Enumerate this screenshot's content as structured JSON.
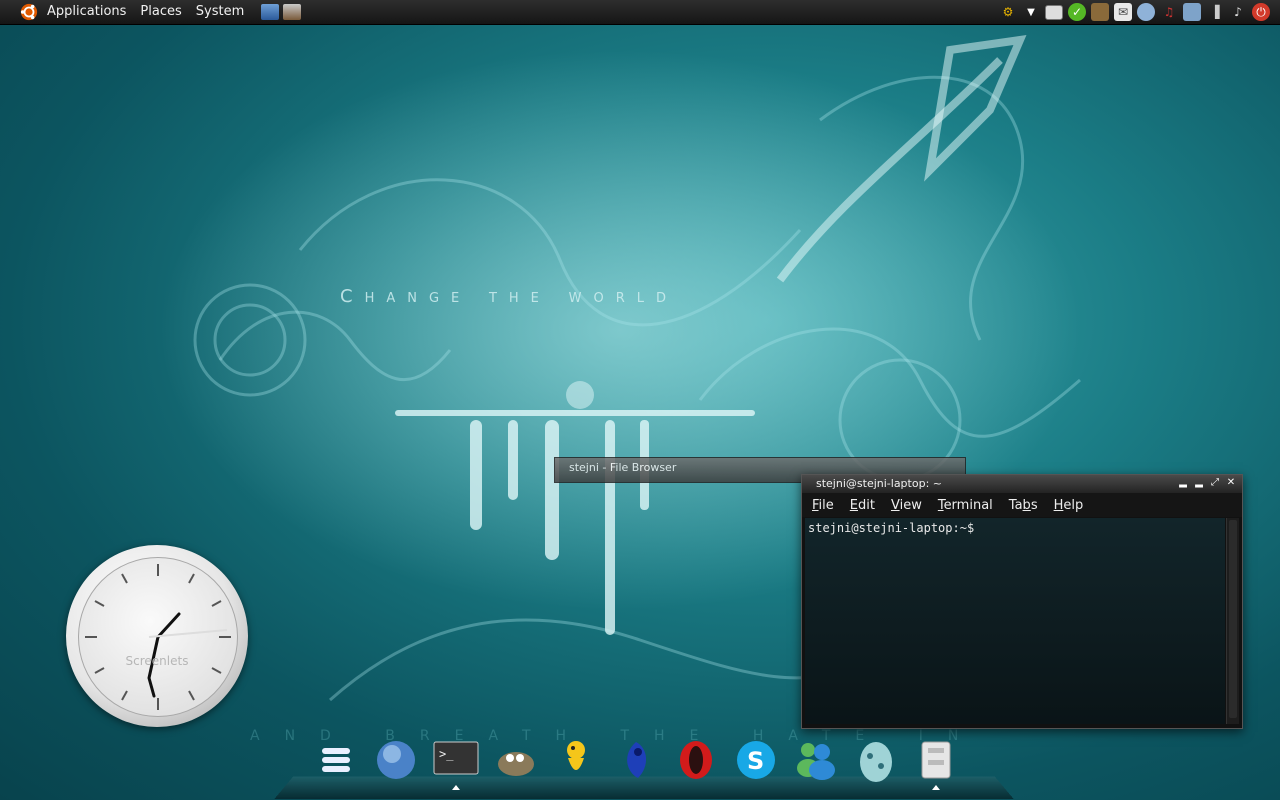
{
  "panel": {
    "menus": [
      "Applications",
      "Places",
      "System"
    ],
    "launchers": [
      "network-tool-icon",
      "screenshot-icon"
    ],
    "tray_icons": [
      "keyboard-icon",
      "display-icon",
      "pidgin-icon",
      "monitor-icon",
      "mail-icon",
      "user-icon",
      "music-icon",
      "network-icon",
      "signal-icon",
      "volume-icon",
      "power-icon"
    ]
  },
  "wallpaper": {
    "title": "Change the world",
    "subtitle": "and breath the hate in"
  },
  "clock": {
    "label": "Screenlets"
  },
  "file_browser": {
    "title": "stejni - File Browser"
  },
  "terminal": {
    "title": "stejni@stejni-laptop: ~",
    "menu": [
      {
        "label": "File",
        "accel": "F"
      },
      {
        "label": "Edit",
        "accel": "E"
      },
      {
        "label": "View",
        "accel": "V"
      },
      {
        "label": "Terminal",
        "accel": "T"
      },
      {
        "label": "Tabs",
        "accel": "b"
      },
      {
        "label": "Help",
        "accel": "H"
      }
    ],
    "prompt": "stejni@stejni-laptop:~$"
  },
  "dock": {
    "items": [
      "menu-icon",
      "web-browser-icon",
      "terminal-icon",
      "gimp-icon",
      "pidgin-icon",
      "games-icon",
      "opera-icon",
      "skype-icon",
      "messenger-icon",
      "egg-icon",
      "files-icon"
    ],
    "active": [
      "terminal-icon",
      "files-icon"
    ]
  }
}
